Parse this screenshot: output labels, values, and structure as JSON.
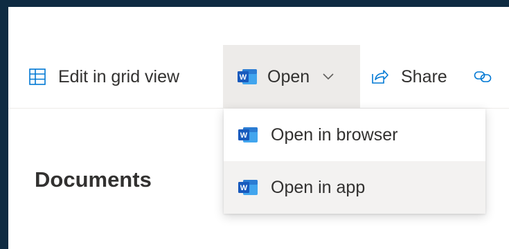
{
  "command_bar": {
    "edit_grid_label": "Edit in grid view",
    "open_label": "Open",
    "share_label": "Share"
  },
  "page": {
    "title": "Documents"
  },
  "open_menu": {
    "items": [
      {
        "label": "Open in browser",
        "icon": "word-icon"
      },
      {
        "label": "Open in app",
        "icon": "word-icon"
      }
    ]
  },
  "colors": {
    "accent": "#0078d4",
    "word_blue": "#185abd",
    "text": "#323130",
    "hover_bg": "#edebe9"
  }
}
